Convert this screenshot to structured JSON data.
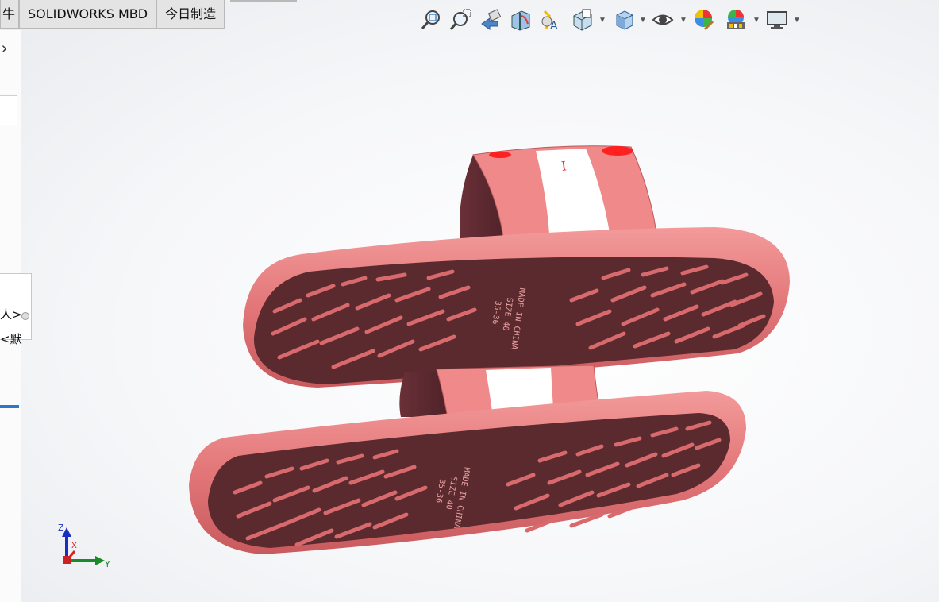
{
  "tabs": {
    "cut_label": "牛",
    "mbd_label": "SOLIDWORKS MBD",
    "manufacture_label": "今日制造"
  },
  "left_panel": {
    "collapse_glyph": "›",
    "flyout_line1": "人>",
    "flyout_line2": "<默"
  },
  "heads_up_toolbar": {
    "icons": [
      "zoom-to-fit-icon",
      "zoom-to-area-icon",
      "previous-view-icon",
      "section-view-icon",
      "dynamic-annotation-icon",
      "view-orientation-icon",
      "display-style-icon",
      "hide-show-items-icon",
      "edit-appearance-icon",
      "apply-scene-icon",
      "view-settings-icon"
    ]
  },
  "triad": {
    "z_label": "Z",
    "x_label": "X",
    "y_label": "Y"
  },
  "model": {
    "strap_mark": "I",
    "sole_text_lines": [
      "MADE IN CHINA",
      "SIZE 40",
      "35-36"
    ],
    "colors": {
      "sole_top": "#e8787a",
      "sole_bottom": "#5a2a2e",
      "strap": "#f08e8e",
      "stripe": "#ffffff",
      "dot": "#ff2020",
      "tread": "#d8696c"
    }
  }
}
